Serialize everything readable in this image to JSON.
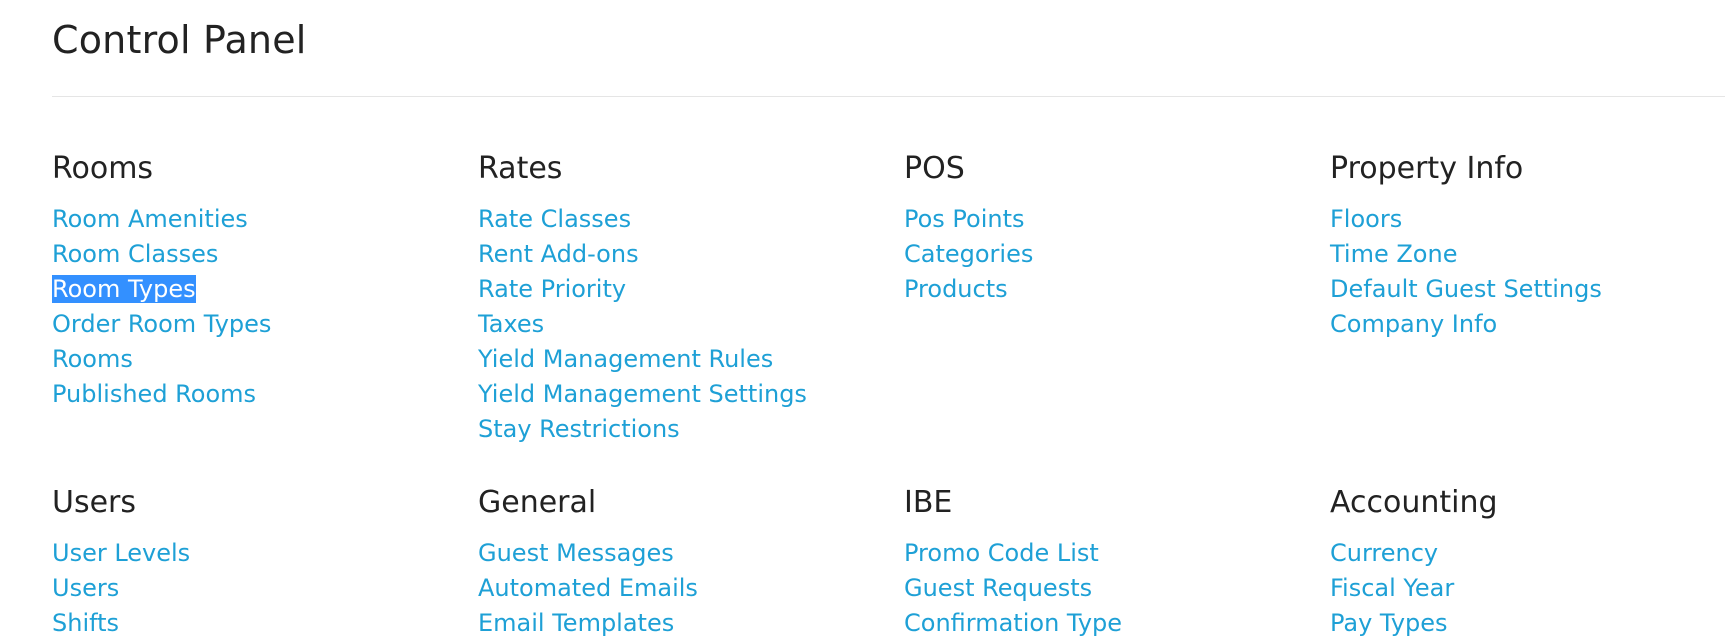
{
  "page": {
    "title": "Control Panel"
  },
  "colors": {
    "link": "#1ea0d6",
    "heading": "#222222",
    "selection_bg": "#3390ff",
    "selection_text": "#ffffff",
    "divider": "#e5e5e5"
  },
  "sections": [
    {
      "title": "Rooms",
      "links": [
        "Room Amenities",
        "Room Classes",
        "Room Types",
        "Order Room Types",
        "Rooms",
        "Published Rooms"
      ],
      "selected_index": 2
    },
    {
      "title": "Rates",
      "links": [
        "Rate Classes",
        "Rent Add-ons",
        "Rate Priority",
        "Taxes",
        "Yield Management Rules",
        "Yield Management Settings",
        "Stay Restrictions"
      ]
    },
    {
      "title": "POS",
      "links": [
        "Pos Points",
        "Categories",
        "Products"
      ]
    },
    {
      "title": "Property Info",
      "links": [
        "Floors",
        "Time Zone",
        "Default Guest Settings",
        "Company Info"
      ]
    },
    {
      "title": "Users",
      "links": [
        "User Levels",
        "Users",
        "Shifts"
      ]
    },
    {
      "title": "General",
      "links": [
        "Guest Messages",
        "Automated Emails",
        "Email Templates"
      ]
    },
    {
      "title": "IBE",
      "links": [
        "Promo Code List",
        "Guest Requests",
        "Confirmation Type"
      ]
    },
    {
      "title": "Accounting",
      "links": [
        "Currency",
        "Fiscal Year",
        "Pay Types"
      ]
    }
  ]
}
